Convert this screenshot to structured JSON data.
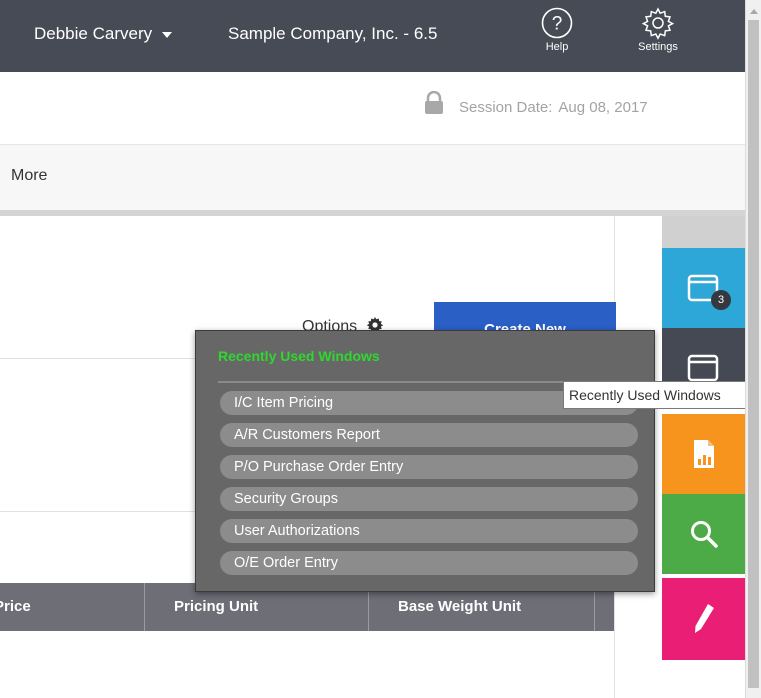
{
  "topbar": {
    "user_name": "Debbie Carvery",
    "company": "Sample Company, Inc. - 6.5",
    "help_label": "Help",
    "settings_label": "Settings"
  },
  "session": {
    "label": "Session Date:",
    "date": "Aug 08, 2017"
  },
  "more_label": "More",
  "toolbar": {
    "options_label": "Options",
    "create_new_label": "Create New"
  },
  "table": {
    "columns": [
      "Price",
      "Pricing Unit",
      "Base Weight Unit"
    ]
  },
  "side_tiles": {
    "windows_badge": "3"
  },
  "recent_windows": {
    "title": "Recently Used Windows",
    "items": [
      "I/C Item Pricing",
      "A/R Customers Report",
      "P/O Purchase Order Entry",
      "Security Groups",
      "User Authorizations",
      "O/E Order Entry"
    ]
  },
  "tooltip": "Recently Used Windows",
  "colors": {
    "topbar": "#474b55",
    "create_button": "#2a5fc5",
    "popup_title": "#2ed82e",
    "tile_windows": "#2da6d8",
    "tile_recent": "#454953",
    "tile_report": "#f7941d",
    "tile_search": "#4cab46",
    "tile_edit": "#ea1e74"
  },
  "icons": [
    "caret-down-icon",
    "help-icon",
    "gear-icon",
    "lock-icon",
    "windows-icon",
    "recent-windows-icon",
    "report-icon",
    "search-icon",
    "pencil-icon"
  ]
}
